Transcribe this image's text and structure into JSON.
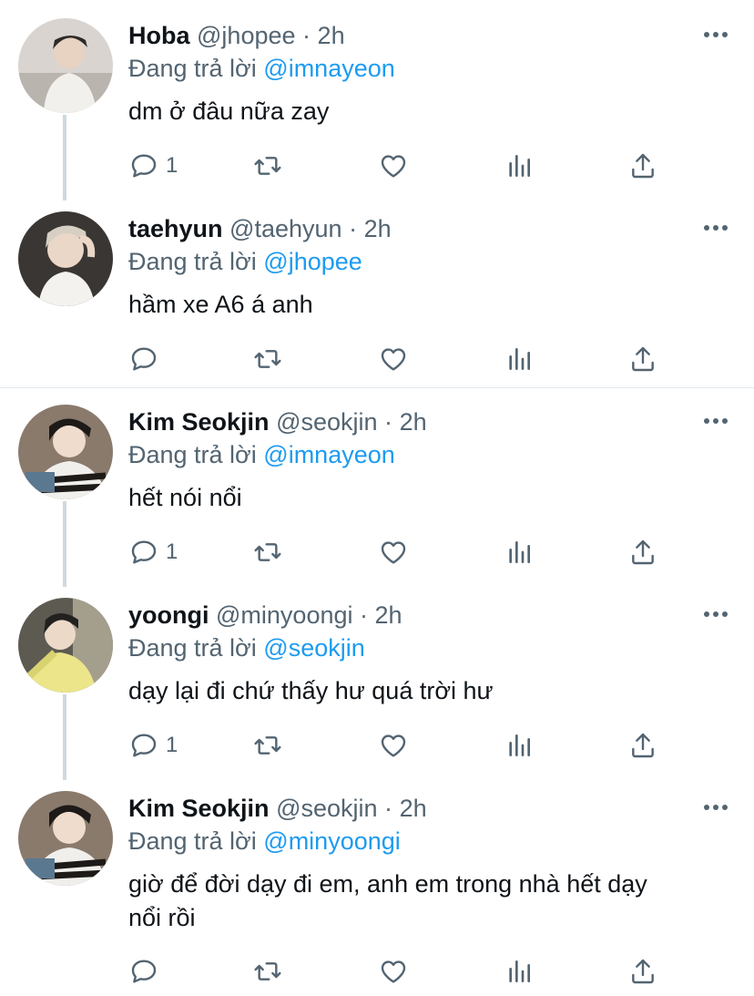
{
  "reply_prefix": "Đang trả lời",
  "tweets": [
    {
      "name": "Hoba",
      "handle": "@jhopee",
      "dot": "·",
      "time": "2h",
      "mention": "@imnayeon",
      "text_lines": [
        "dm ở đâu nữa zay"
      ],
      "reply_count": "1"
    },
    {
      "name": "taehyun",
      "handle": "@taehyun",
      "dot": "·",
      "time": "2h",
      "mention": "@jhopee",
      "text_lines": [
        "hầm xe A6 á anh"
      ],
      "reply_count": ""
    },
    {
      "name": "Kim Seokjin",
      "handle": "@seokjin",
      "dot": "·",
      "time": "2h",
      "mention": "@imnayeon",
      "text_lines": [
        "hết nói nổi"
      ],
      "reply_count": "1"
    },
    {
      "name": "yoongi",
      "handle": "@minyoongi",
      "dot": "·",
      "time": "2h",
      "mention": "@seokjin",
      "text_lines": [
        "dạy lại đi chứ thấy hư quá trời hư"
      ],
      "reply_count": "1"
    },
    {
      "name": "Kim Seokjin",
      "handle": "@seokjin",
      "dot": "·",
      "time": "2h",
      "mention": "@minyoongi",
      "text_lines": [
        "giờ để đời dạy đi em, anh em trong nhà hết dạy",
        "nổi rồi"
      ],
      "reply_count": ""
    }
  ],
  "icons": {
    "reply": "reply-icon",
    "retweet": "retweet-icon",
    "like": "like-icon",
    "analytics": "analytics-icon",
    "share": "share-icon",
    "more": "more-icon"
  },
  "colors": {
    "accent": "#1d9bf0",
    "secondary_text": "#536471",
    "primary_text": "#0f1419",
    "thread_line": "#cfd9de"
  }
}
